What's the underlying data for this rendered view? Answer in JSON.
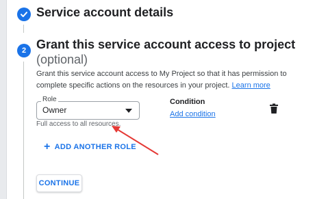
{
  "steps": [
    {
      "number": "",
      "title": "Service account details",
      "state": "complete",
      "icon": "check-icon"
    },
    {
      "number": "2",
      "title": "Grant this service account access to project",
      "subtitle": "(optional)",
      "state": "active"
    }
  ],
  "description": {
    "text": "Grant this service account access to My Project so that it has permission to complete specific actions on the resources in your project.",
    "link": "Learn more"
  },
  "role": {
    "label": "Role",
    "value": "Owner",
    "helper": "Full access to all resources."
  },
  "condition": {
    "label": "Condition",
    "add_link": "Add condition"
  },
  "delete_icon": "trash-icon",
  "add_role": {
    "icon": "plus-icon",
    "label": "ADD ANOTHER ROLE"
  },
  "continue_label": "CONTINUE",
  "colors": {
    "accent": "#1a73e8",
    "annotation_arrow": "#e53935"
  }
}
